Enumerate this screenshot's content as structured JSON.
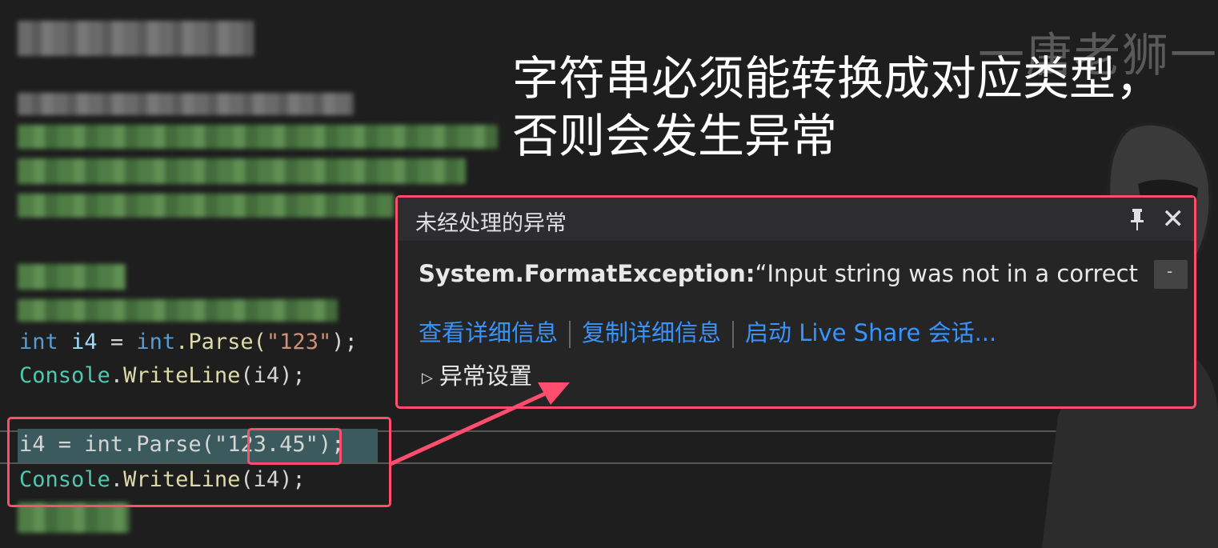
{
  "watermark": "一唐老狮一",
  "annotation": {
    "line1": "字符串必须能转换成对应类型，",
    "line2": "否则会发生异常"
  },
  "code": {
    "line1": {
      "kw": "int",
      "var": "i4",
      "eq": " = ",
      "kw2": "int",
      "call": ".Parse(",
      "str": "\"123\"",
      "end": ");"
    },
    "line2": {
      "type": "Console",
      "dot": ".",
      "fn": "WriteLine",
      "rest": "(i4);"
    },
    "line3": {
      "pre": "i4 = int.Parse(\"",
      "str": "123.45",
      "end": "\");"
    },
    "line4": {
      "type": "Console",
      "dot": ".",
      "fn": "WriteLine",
      "rest": "(i4);"
    }
  },
  "popup": {
    "title": "未经处理的异常",
    "close_glyph": "✕",
    "exception_type": "System.FormatException:",
    "exception_message": "“Input string was not in a correct",
    "scroll_glyph": "-",
    "links": [
      "查看详细信息",
      "复制详细信息",
      "启动 Live Share 会话..."
    ],
    "settings_label": "异常设置",
    "settings_glyph": "▷"
  },
  "colors": {
    "accent_red": "#ff4d6d",
    "link_blue": "#3794ff",
    "background": "#1e1e1e"
  }
}
